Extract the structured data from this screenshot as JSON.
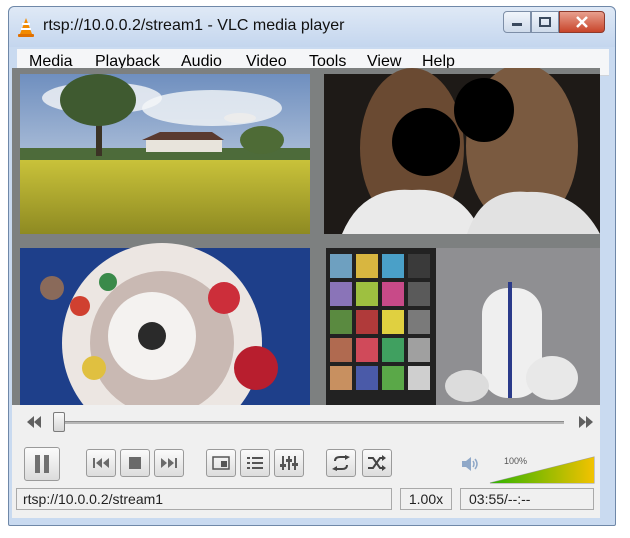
{
  "window": {
    "title": "rtsp://10.0.0.2/stream1 - VLC media player"
  },
  "menu": [
    "Media",
    "Playback",
    "Audio",
    "Video",
    "Tools",
    "View",
    "Help"
  ],
  "seek": {
    "position": 0.0
  },
  "volume": {
    "label": "100%",
    "level": 1.0
  },
  "status": {
    "source": "rtsp://10.0.0.2/stream1",
    "speed": "1.00x",
    "time": "03:55/--:--"
  },
  "icons": {
    "app": "vlc-cone-icon",
    "minimize": "minimize-icon",
    "maximize": "maximize-icon",
    "close": "close-icon",
    "pause": "pause-icon",
    "previous": "previous-icon",
    "stop": "stop-icon",
    "next": "next-icon",
    "fullscreen": "fullscreen-icon",
    "playlist": "playlist-icon",
    "extended": "equalizer-icon",
    "loop": "loop-icon",
    "shuffle": "shuffle-icon",
    "speaker": "speaker-icon"
  },
  "colors": {
    "volume_low": "#2db300",
    "volume_high": "#f2c200"
  }
}
